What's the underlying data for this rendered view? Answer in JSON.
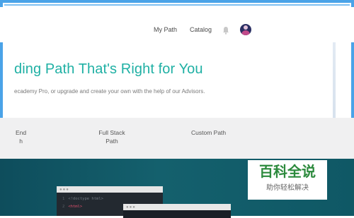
{
  "nav": {
    "my_path": "My Path",
    "catalog": "Catalog"
  },
  "hero": {
    "title": "ding Path That's Right for You",
    "subtitle": "ecademy Pro, or upgrade and create your own with the help of our Advisors."
  },
  "tabs": [
    {
      "line1": "End",
      "line2": "h"
    },
    {
      "line1": "Full Stack",
      "line2": "Path"
    },
    {
      "line1": "Custom Path",
      "line2": ""
    }
  ],
  "code": {
    "dots": "●●●",
    "lines": [
      {
        "num": "1",
        "text": "<!doctype html>"
      },
      {
        "num": "2",
        "text": "<html>"
      }
    ]
  },
  "watermark": {
    "big": "百科全说",
    "small": "助你轻松解决"
  },
  "colors": {
    "accent": "#1fb0a4",
    "frame": "#4aa3e8"
  },
  "icons": {
    "bell": "bell-icon",
    "avatar": "avatar"
  }
}
